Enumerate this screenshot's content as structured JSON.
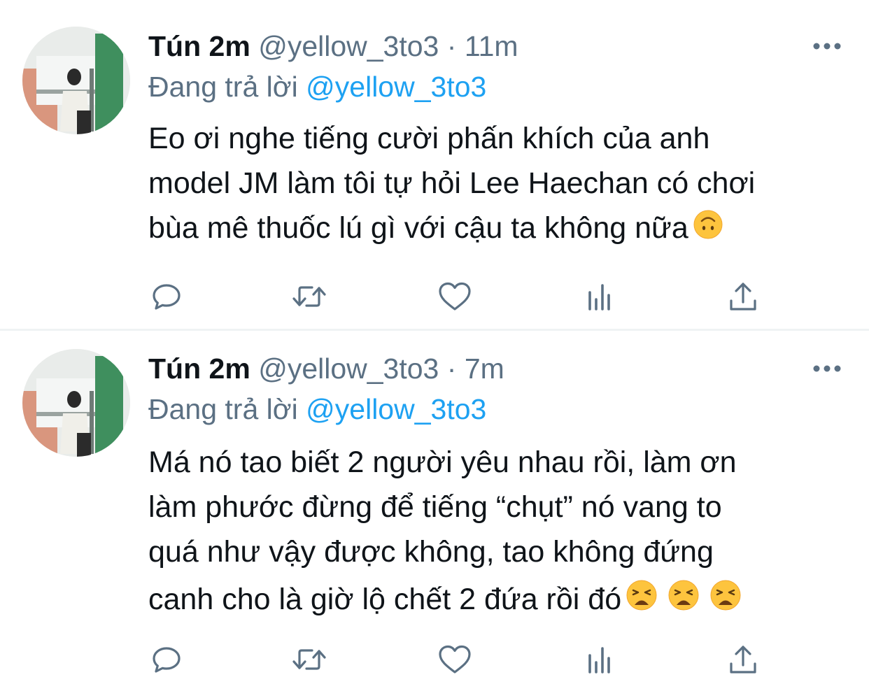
{
  "tweets": [
    {
      "name": "Tún 2m",
      "handle": "@yellow_3to3",
      "separator": "·",
      "time": "11m",
      "reply_prefix": "Đang trả lời",
      "reply_to": "@yellow_3to3",
      "lines": [
        "Eo ơi nghe tiếng cười phấn khích của anh",
        "model JM làm tôi tự hỏi Lee Haechan có chơi",
        "bùa mê thuốc lú gì với cậu ta không nữa"
      ],
      "emojis": [
        "upside-down-face"
      ]
    },
    {
      "name": "Tún 2m",
      "handle": "@yellow_3to3",
      "separator": "·",
      "time": "7m",
      "reply_prefix": "Đang trả lời",
      "reply_to": "@yellow_3to3",
      "lines": [
        "Má nó tao biết 2 người yêu nhau rồi, làm ơn",
        "làm phước đừng để tiếng “chụt” nó vang to",
        "quá như vậy được không, tao không đứng",
        "canh cho là giờ lộ chết 2 đứa rồi đó"
      ],
      "emojis": [
        "weary-face",
        "weary-face",
        "weary-face"
      ]
    }
  ],
  "icons": {
    "more": "more-horizontal-icon",
    "reply": "reply-icon",
    "retweet": "retweet-icon",
    "like": "heart-icon",
    "analytics": "analytics-icon",
    "share": "share-icon"
  },
  "colors": {
    "text": "#0f1419",
    "secondary": "#5b7083",
    "link": "#1da1f2",
    "divider": "#eff3f4",
    "emoji": "#fdc43e"
  }
}
